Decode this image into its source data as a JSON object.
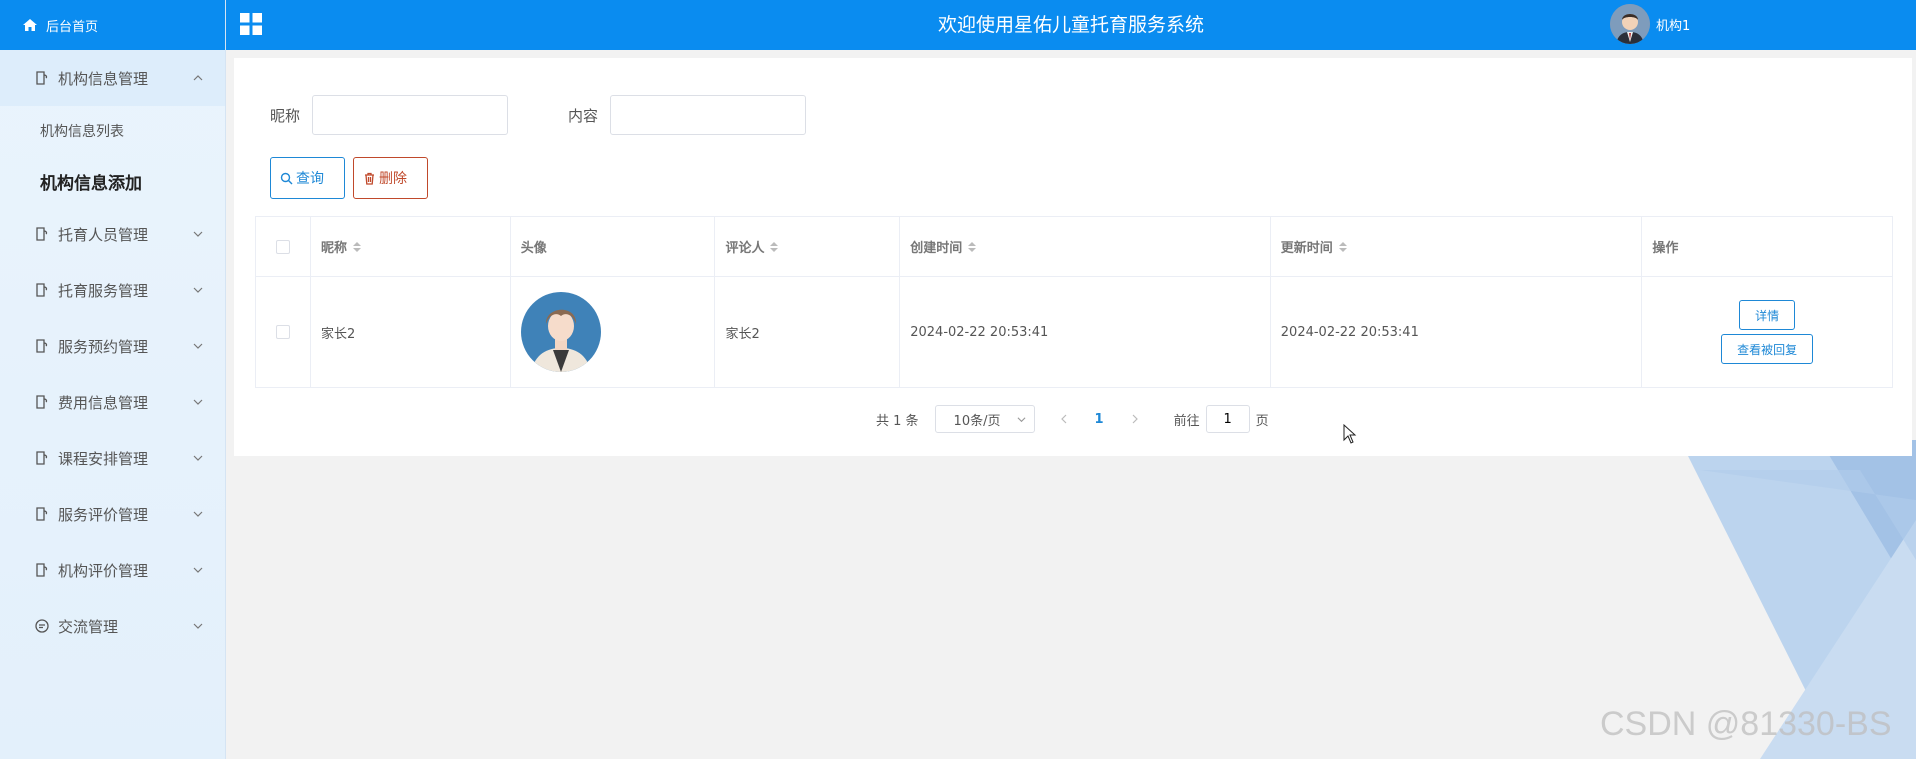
{
  "sidebar": {
    "home_label": "后台首页",
    "open_menu": "机构信息管理",
    "sub_items": [
      "机构信息列表",
      "机构信息添加"
    ],
    "menus": [
      "托育人员管理",
      "托育服务管理",
      "服务预约管理",
      "费用信息管理",
      "课程安排管理",
      "服务评价管理",
      "机构评价管理",
      "交流管理"
    ]
  },
  "header": {
    "title": "欢迎使用星佑儿童托育服务系统",
    "username": "机构1"
  },
  "search": {
    "nickname_label": "昵称",
    "content_label": "内容",
    "nickname_value": "",
    "content_value": "",
    "search_button": "查询",
    "delete_button": "删除"
  },
  "table": {
    "headers": [
      "昵称",
      "头像",
      "评论人",
      "创建时间",
      "更新时间",
      "操作"
    ],
    "rows": [
      {
        "nickname": "家长2",
        "commenter": "家长2",
        "created": "2024-02-22 20:53:41",
        "updated": "2024-02-22 20:53:41",
        "detail_button": "详情",
        "reply_button": "查看被回复"
      }
    ]
  },
  "pagination": {
    "total": "共 1 条",
    "page_size": "10条/页",
    "current": "1",
    "goto_prefix": "前往",
    "goto_value": "1",
    "goto_suffix": "页"
  },
  "watermark": "CSDN @81330-BS",
  "colors": {
    "primary": "#0a8cf0",
    "danger": "#c0492b",
    "accent": "#1e88d6"
  }
}
